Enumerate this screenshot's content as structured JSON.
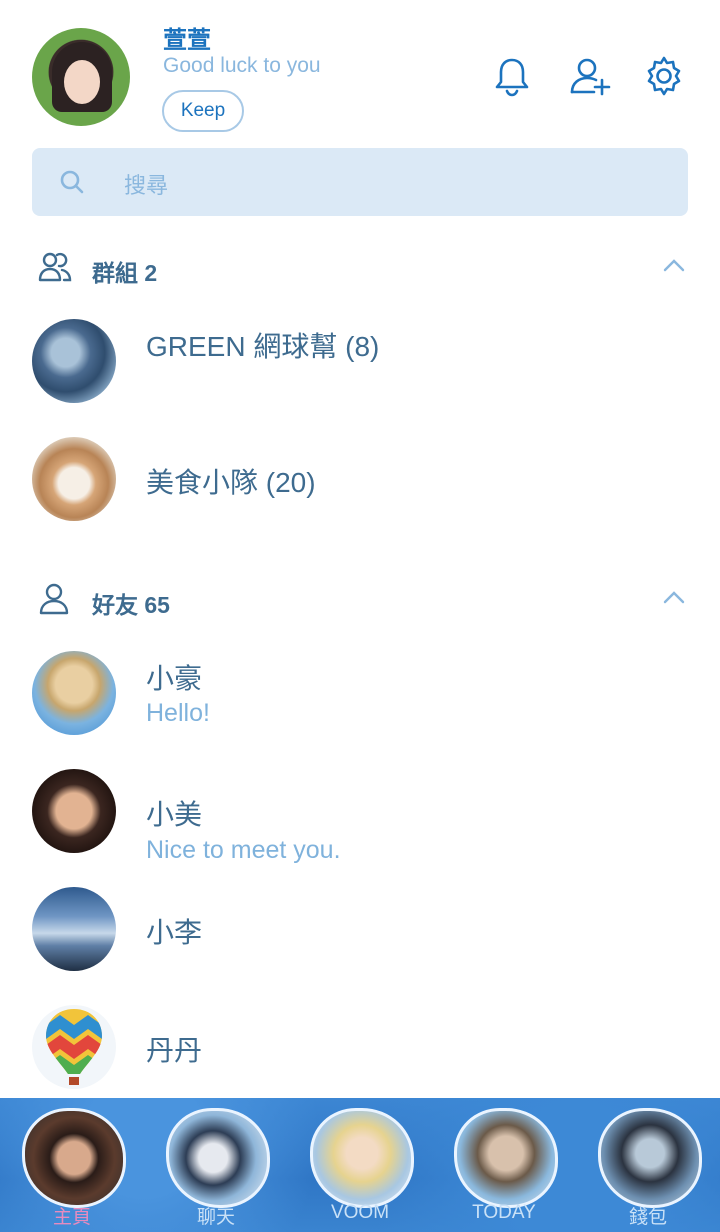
{
  "profile": {
    "name": "萱萱",
    "status": "Good luck to you",
    "keep_label": "Keep",
    "icons": [
      "bell-icon",
      "add-friend-icon",
      "gear-icon"
    ]
  },
  "search": {
    "placeholder": "搜尋"
  },
  "groups": {
    "label": "群組 2",
    "items": [
      {
        "name": "GREEN 網球幫 (8)"
      },
      {
        "name": "美食小隊 (20)"
      }
    ]
  },
  "friends": {
    "label": "好友 65",
    "items": [
      {
        "name": "小豪",
        "status": "Hello!"
      },
      {
        "name": "小美",
        "status": "Nice to meet you."
      },
      {
        "name": "小李",
        "status": ""
      },
      {
        "name": "丹丹",
        "status": ""
      }
    ]
  },
  "tabs": [
    {
      "label": "主頁",
      "active": true
    },
    {
      "label": "聊天",
      "active": false
    },
    {
      "label": "VOOM",
      "active": false
    },
    {
      "label": "TODAY",
      "active": false
    },
    {
      "label": "錢包",
      "active": false
    }
  ],
  "colors": {
    "accent": "#1c73be",
    "muted_text": "#8ab7de",
    "section_text": "#3e6b8f",
    "search_bg": "#dbe9f6",
    "active_tab": "#e78bbf"
  }
}
